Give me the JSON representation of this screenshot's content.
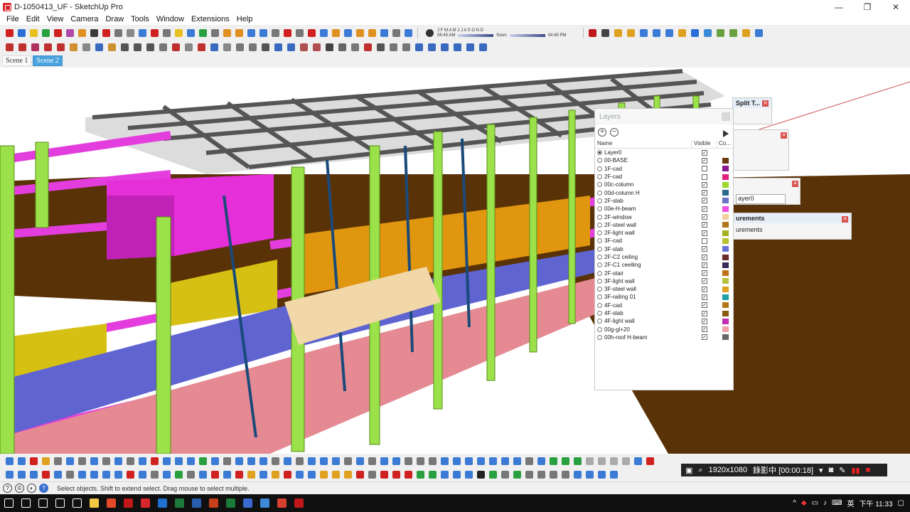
{
  "window": {
    "title": "D-1050413_UF - SketchUp Pro",
    "minimize": "—",
    "restore": "❐",
    "close": "✕"
  },
  "menu": [
    "File",
    "Edit",
    "View",
    "Camera",
    "Draw",
    "Tools",
    "Window",
    "Extensions",
    "Help"
  ],
  "toolbar1_colors": [
    "#d02020",
    "#2a6fd6",
    "#e8c020",
    "#28a040",
    "#d02020",
    "#b04aa8",
    "#e09020",
    "#3a3a3a",
    "#d02020",
    "#777",
    "#888",
    "#3b7bd6",
    "#d02020",
    "#777",
    "#e8c020",
    "#3b7bd6",
    "#28a040",
    "#777",
    "#e09020",
    "#e09020",
    "#3b7bd6",
    "#3b7bd6",
    "#777",
    "#d02020",
    "#777",
    "#d02020",
    "#3b7bd6",
    "#e09020",
    "#3b7bd6",
    "#e09020",
    "#e09020",
    "#3b7bd6",
    "#777",
    "#3b7bd6"
  ],
  "shadow": {
    "months": "J F M A M J J A S O N D",
    "time_start": "06:43 AM",
    "time_noon": "Noon",
    "time_end": "04:45 PM"
  },
  "toolbar1_right_colors": [
    "#c01818",
    "#444",
    "#e0a020",
    "#e0a020",
    "#3b7bd6",
    "#3b7bd6",
    "#3b7bd6",
    "#e0a020",
    "#2a6fd6",
    "#3a8ad6",
    "#6aa040",
    "#6aa040",
    "#e0a020",
    "#3b7bd6"
  ],
  "toolbar2_colors": [
    "#c03030",
    "#c03030",
    "#b03060",
    "#c03030",
    "#c03030",
    "#d09030",
    "#888",
    "#3a6ac0",
    "#d09030",
    "#555",
    "#555",
    "#555",
    "#777",
    "#c03030",
    "#888",
    "#c03030",
    "#3a6ac0",
    "#888",
    "#777",
    "#777",
    "#555",
    "#3a6ac0",
    "#3a6ac0",
    "#b05050",
    "#b05050",
    "#444",
    "#666",
    "#777",
    "#c03030",
    "#555",
    "#777",
    "#777",
    "#3a6ac0",
    "#3a6ac0",
    "#3a6ac0",
    "#3a6ac0",
    "#3a6ac0",
    "#3a6ac0"
  ],
  "scenes": [
    {
      "label": "Scene 1",
      "active": false
    },
    {
      "label": "Scene 2",
      "active": true
    }
  ],
  "layers_panel": {
    "title": "Layers",
    "add": "+",
    "remove": "−",
    "columns": {
      "name": "Name",
      "visible": "Visible",
      "color": "Co..."
    },
    "rows": [
      {
        "name": "Layer0",
        "current": true,
        "visible": true,
        "color": "#ffffff"
      },
      {
        "name": "00-BASE",
        "current": false,
        "visible": true,
        "color": "#6b3a10"
      },
      {
        "name": "1F-cad",
        "current": false,
        "visible": false,
        "color": "#8a1a8a"
      },
      {
        "name": "2F-cad",
        "current": false,
        "visible": false,
        "color": "#e0207a"
      },
      {
        "name": "00c-column",
        "current": false,
        "visible": true,
        "color": "#9ad82a"
      },
      {
        "name": "00d-column H",
        "current": false,
        "visible": true,
        "color": "#2a6a8a"
      },
      {
        "name": "2F-slab",
        "current": false,
        "visible": true,
        "color": "#6a72c8"
      },
      {
        "name": "00e-H-beam",
        "current": false,
        "visible": true,
        "color": "#f050e0"
      },
      {
        "name": "2F-window",
        "current": false,
        "visible": true,
        "color": "#f0d0a0"
      },
      {
        "name": "2F-steel wall",
        "current": false,
        "visible": true,
        "color": "#b07818"
      },
      {
        "name": "2F-light wall",
        "current": false,
        "visible": true,
        "color": "#a8b020"
      },
      {
        "name": "3F-cad",
        "current": false,
        "visible": false,
        "color": "#b8c030"
      },
      {
        "name": "3F-slab",
        "current": false,
        "visible": true,
        "color": "#6a70d8"
      },
      {
        "name": "2F-C2 ceiling",
        "current": false,
        "visible": true,
        "color": "#6a2a2a"
      },
      {
        "name": "2F-C1 ceeiling",
        "current": false,
        "visible": true,
        "color": "#3a2a5a"
      },
      {
        "name": "2F-stair",
        "current": false,
        "visible": true,
        "color": "#c07018"
      },
      {
        "name": "3F-light wall",
        "current": false,
        "visible": true,
        "color": "#b8c040"
      },
      {
        "name": "3F-steel wall",
        "current": false,
        "visible": true,
        "color": "#e0a020"
      },
      {
        "name": "3F-railing 01",
        "current": false,
        "visible": true,
        "color": "#20a0a8"
      },
      {
        "name": "4F-cad",
        "current": false,
        "visible": true,
        "color": "#b07818"
      },
      {
        "name": "4F-slab",
        "current": false,
        "visible": true,
        "color": "#8a5a10"
      },
      {
        "name": "4F-light wall",
        "current": false,
        "visible": true,
        "color": "#c030b0"
      },
      {
        "name": "00g-gl+20",
        "current": false,
        "visible": true,
        "color": "#f0a0a8"
      },
      {
        "name": "00h-roof H-beam",
        "current": false,
        "visible": true,
        "color": "#666666"
      }
    ]
  },
  "split_panel": {
    "title": "Split T..."
  },
  "layer_dropdown": {
    "value": "ayer0"
  },
  "measurements_panel": {
    "title": "urements",
    "body": "urements"
  },
  "bottom_toolbar1_colors": [
    "#3b7bd6",
    "#3b7bd6",
    "#d02020",
    "#e0a020",
    "#777",
    "#3b7bd6",
    "#777",
    "#3b7bd6",
    "#777",
    "#3b7bd6",
    "#777",
    "#3b7bd6",
    "#d02020",
    "#3b7bd6",
    "#3b7bd6",
    "#3b7bd6",
    "#28a040",
    "#3b7bd6",
    "#777",
    "#3b7bd6",
    "#3b7bd6",
    "#3b7bd6",
    "#777",
    "#3b7bd6",
    "#777",
    "#3b7bd6",
    "#3b7bd6",
    "#3b7bd6",
    "#777",
    "#3b7bd6",
    "#777",
    "#3b7bd6",
    "#3b7bd6",
    "#777",
    "#777",
    "#777",
    "#3b7bd6",
    "#3b7bd6",
    "#3b7bd6",
    "#3b7bd6",
    "#3b7bd6",
    "#3b7bd6",
    "#3b7bd6",
    "#777",
    "#3b7bd6",
    "#28a040",
    "#28a040",
    "#28a040",
    "#aaa",
    "#aaa",
    "#aaa",
    "#aaa",
    "#3b7bd6",
    "#d02020"
  ],
  "bottom_toolbar2_colors": [
    "#3b7bd6",
    "#3b7bd6",
    "#3b7bd6",
    "#d02020",
    "#3b7bd6",
    "#777",
    "#3b7bd6",
    "#3b7bd6",
    "#3b7bd6",
    "#3b7bd6",
    "#d02020",
    "#3b7bd6",
    "#777",
    "#3b7bd6",
    "#28a040",
    "#777",
    "#3b7bd6",
    "#d02020",
    "#3b7bd6",
    "#d02020",
    "#e0a020",
    "#3b7bd6",
    "#e0a020",
    "#d02020",
    "#3b7bd6",
    "#3b7bd6",
    "#e0a020",
    "#e0a020",
    "#e0a020",
    "#d02020",
    "#777",
    "#d02020",
    "#d02020",
    "#d02020",
    "#28a040",
    "#28a040",
    "#3b7bd6",
    "#3b7bd6",
    "#3b7bd6",
    "#222",
    "#28a040",
    "#777",
    "#28a040",
    "#777",
    "#777",
    "#777",
    "#777",
    "#3b7bd6",
    "#3b7bd6",
    "#3b7bd6",
    "#3b7bd6"
  ],
  "recorder": {
    "resolution": "1920x1080",
    "status": "錄影中 [00:00:18]"
  },
  "statusbar": {
    "hint": "Select objects. Shift to extend select. Drag mouse to select multiple."
  },
  "taskbar": {
    "apps": [
      "#ffffff",
      "#ffffff",
      "#ffffff",
      "#ffffff",
      "#ffffff",
      "#f2c744",
      "#e24a2a",
      "#c01818",
      "#d8262c",
      "#1e6fd0",
      "#1e7a3a",
      "#2a5fb0",
      "#c8401a",
      "#1a7a3a",
      "#3a6ad0",
      "#3b8ad8",
      "#d84030",
      "#c01818"
    ],
    "ime": "英",
    "clock": "下午 11:33"
  }
}
